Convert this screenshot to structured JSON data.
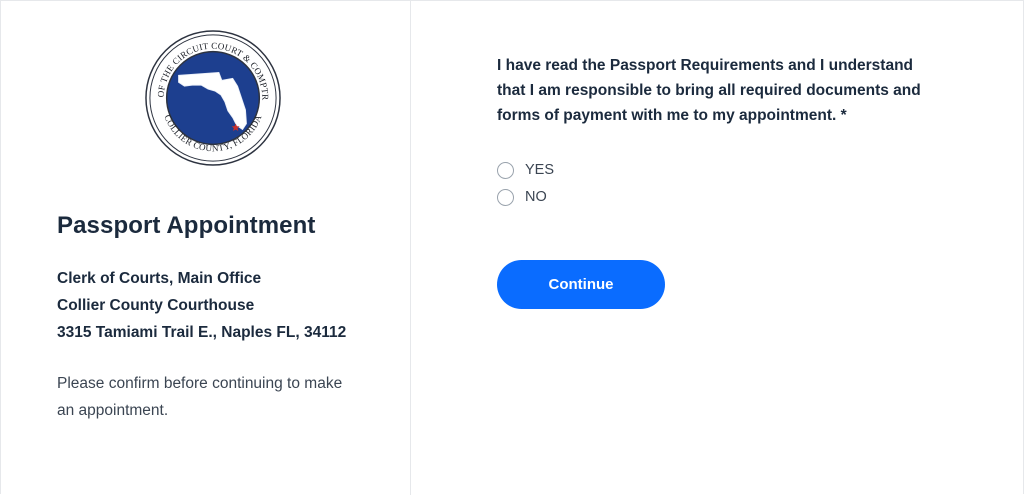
{
  "logo": {
    "seal_text_top": "CLERK OF THE CIRCUIT COURT & COMPTROLLER",
    "seal_text_bottom": "COLLIER COUNTY, FLORIDA",
    "icon": "florida-state-seal"
  },
  "left": {
    "title": "Passport Appointment",
    "address": [
      "Clerk of Courts, Main Office",
      "Collier County Courthouse",
      "3315 Tamiami Trail E., Naples FL, 34112"
    ],
    "note": "Please confirm before continuing to make an appointment."
  },
  "form": {
    "question": "I have read the Passport Requirements and I understand that I am responsible to bring all required documents and forms of payment with me to my appointment. *",
    "options": [
      "YES",
      "NO"
    ],
    "selected": null,
    "continue_label": "Continue"
  },
  "colors": {
    "accent": "#0a6cff",
    "seal_blue": "#1d3f8f",
    "heading": "#1b2a3d",
    "body_text": "#3b4552"
  }
}
